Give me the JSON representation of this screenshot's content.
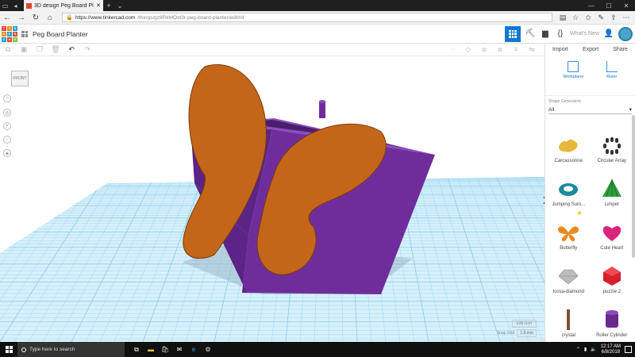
{
  "browser": {
    "tab_title": "3D design Peg Board Pl",
    "url_domain": "https://www.tinkercad.com",
    "url_path": "/things/gz8RkMOxt3r-peg-board-planter/edit#d"
  },
  "app": {
    "logo_letters": [
      "TIN",
      "KER",
      "CAD"
    ],
    "project_title": "Peg Board Planter",
    "whats_new": "What's New"
  },
  "viewcube": {
    "face_label": "FRONT"
  },
  "panel": {
    "actions": [
      "Import",
      "Export",
      "Share"
    ],
    "tools": [
      {
        "label": "Workplane",
        "icon": "workplane-icon"
      },
      {
        "label": "Ruler",
        "icon": "ruler-icon"
      }
    ],
    "shape_generators_label": "Shape Generators",
    "shape_generators_value": "All",
    "shapes": [
      {
        "label": "Carcassonne",
        "icon": "carcassonne-icon",
        "color": "#e7b83a"
      },
      {
        "label": "Circular Array",
        "icon": "circular-array-icon",
        "color": "#333333"
      },
      {
        "label": "Jumping Sum...",
        "icon": "jumping-sum-icon",
        "color": "#1b8a9a"
      },
      {
        "label": "Limpet",
        "icon": "limpet-icon",
        "color": "#2e9e3e"
      },
      {
        "label": "Butterfly",
        "icon": "butterfly-icon",
        "color": "#e98a1e"
      },
      {
        "label": "Cute Heart",
        "icon": "cute-heart-icon",
        "color": "#d9257a"
      },
      {
        "label": "Icosa-diamond",
        "icon": "icosa-diamond-icon",
        "color": "#bbbbbb"
      },
      {
        "label": "puzzle 2",
        "icon": "puzzle-icon",
        "color": "#d81f2a"
      },
      {
        "label": "crystal",
        "icon": "crystal-icon",
        "color": "#7a5430"
      },
      {
        "label": "Roller Cylinder",
        "icon": "roller-cylinder-icon",
        "color": "#6a2a8a"
      }
    ]
  },
  "snap": {
    "edit_grid": "Edit Grid",
    "snap_grid_label": "Snap Grid",
    "snap_grid_value": "1.0 mm"
  },
  "model": {
    "planter_color": "#6f2d9c",
    "butterfly_color": "#c4661a",
    "grid_color": "#8fd0ee"
  },
  "taskbar": {
    "search_placeholder": "Type here to search",
    "time": "12:17 AM",
    "date": "6/8/2018"
  }
}
